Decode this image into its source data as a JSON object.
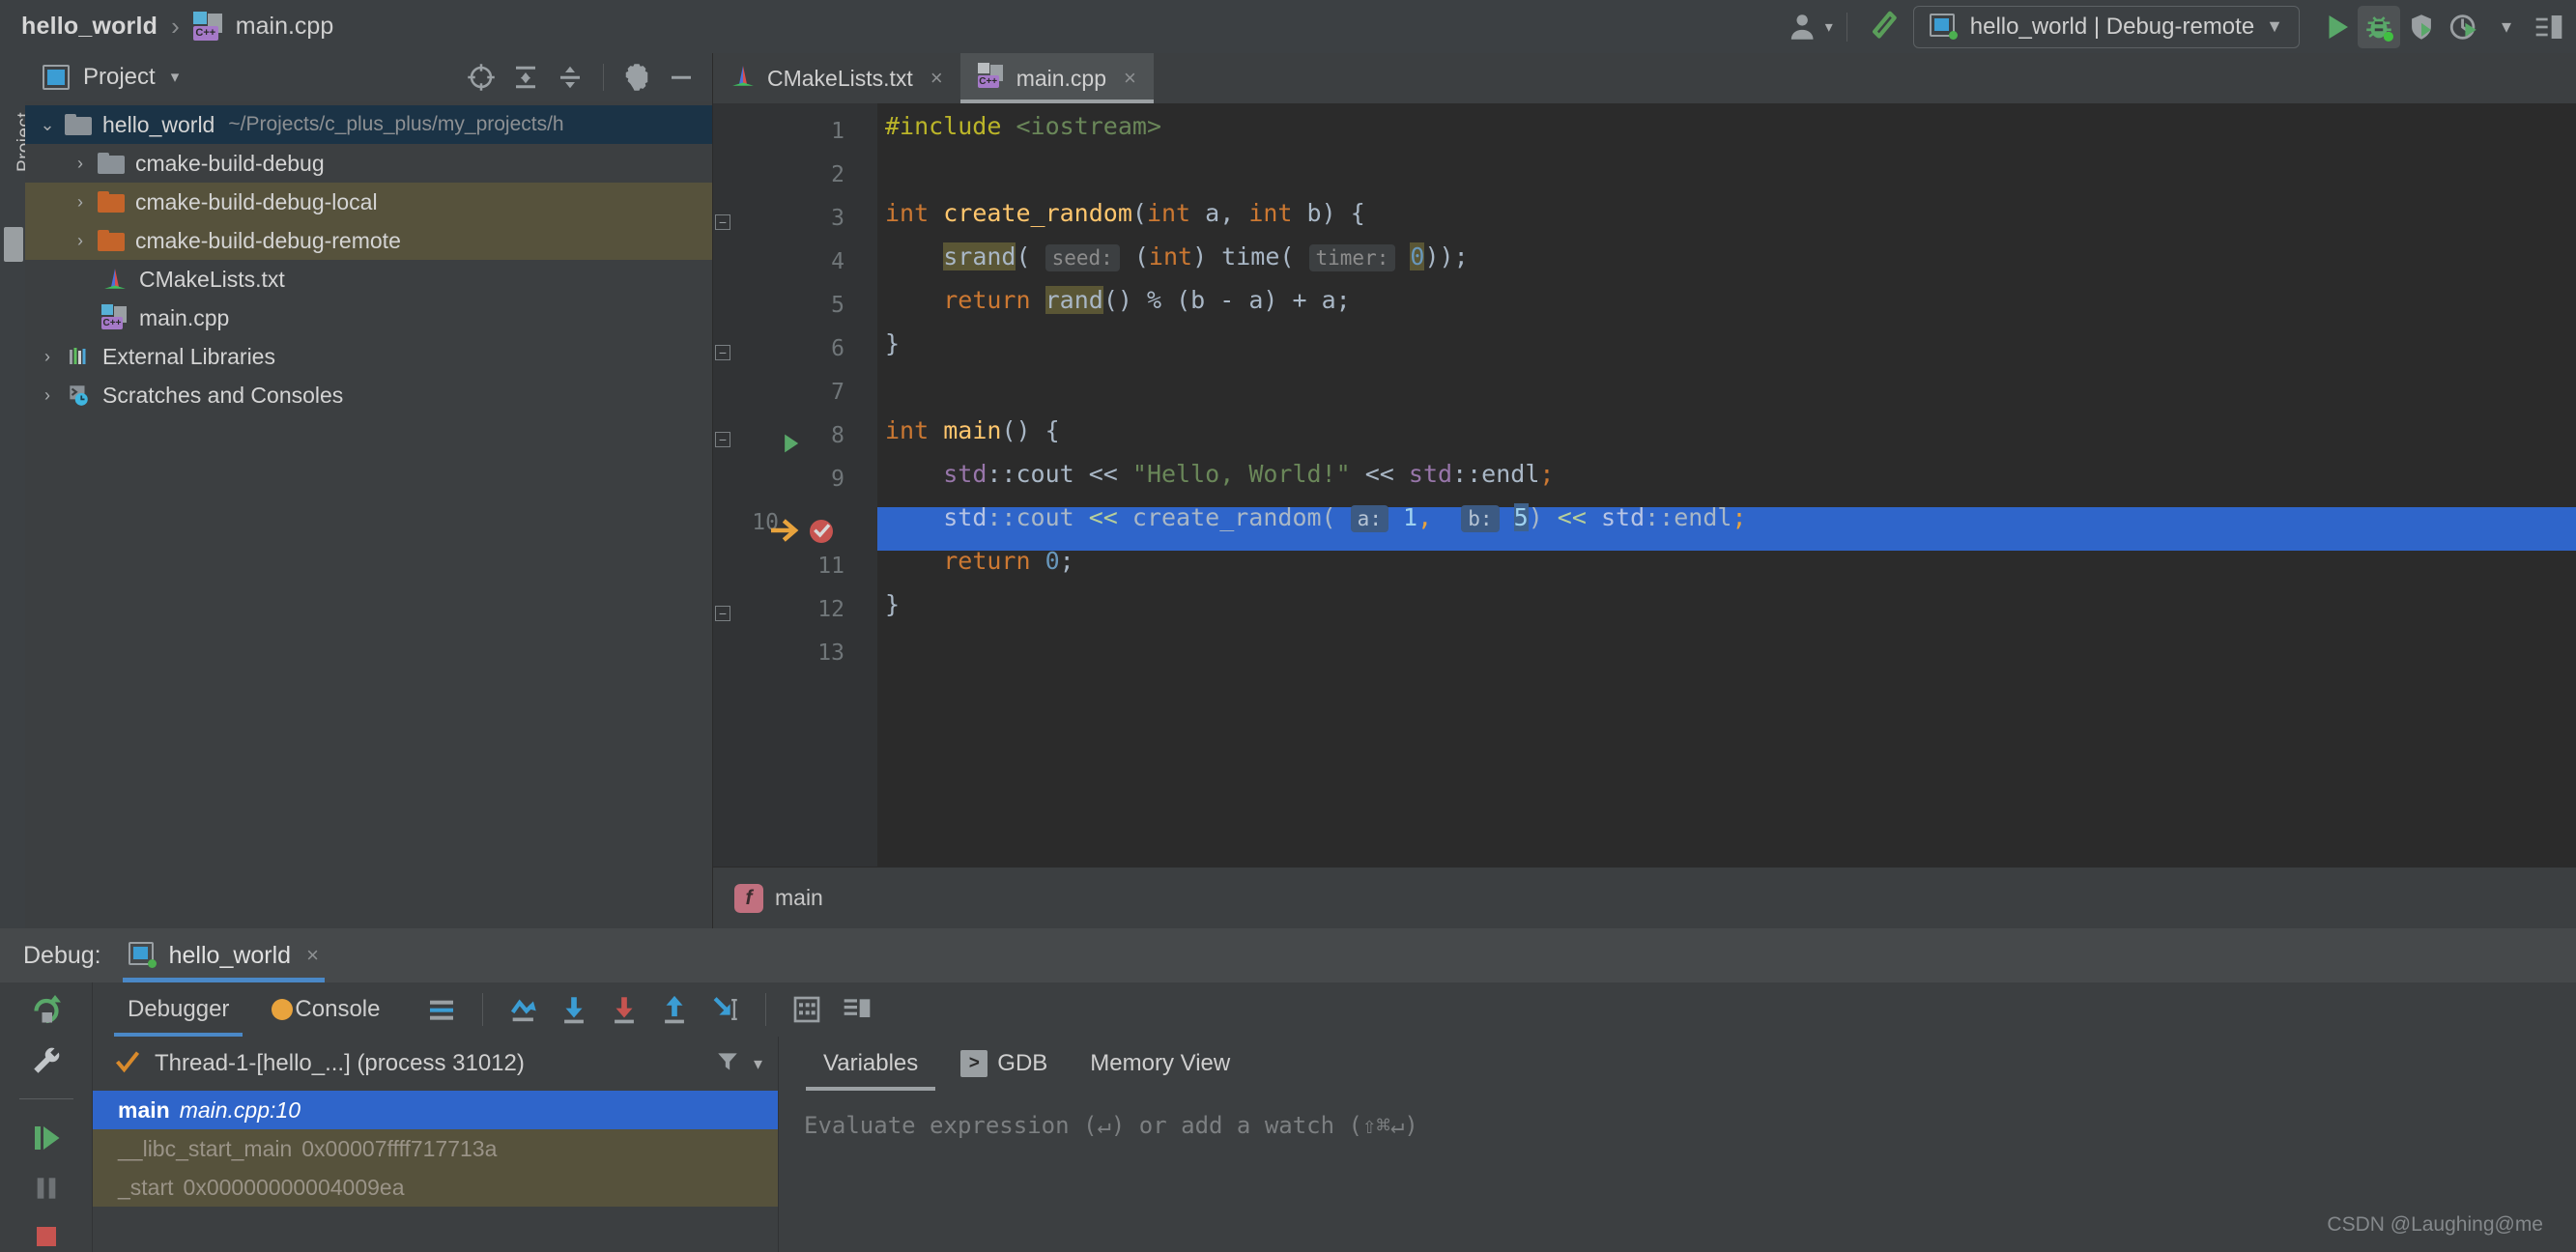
{
  "topbar": {
    "breadcrumb": {
      "project": "hello_world",
      "separator": "›",
      "file": "main.cpp"
    },
    "run_config": {
      "label": "hello_world | Debug-remote",
      "chevron": "▼"
    },
    "icons": {
      "user": "user-account-icon",
      "user_chevron": "▾",
      "hammer": "build-hammer-icon",
      "run": "run-icon",
      "debug": "debug-icon",
      "attach": "attach-to-process-icon",
      "profile": "profile-icon",
      "profile_chevron": "▾",
      "more": "more-toolbar-icon"
    }
  },
  "left_rail": {
    "label": "Project"
  },
  "project_panel": {
    "title": "Project",
    "title_chevron": "▾",
    "toolbar": {
      "locate": "locate-target-icon",
      "expand_all": "expand-all-icon",
      "collapse_all": "collapse-all-icon",
      "settings": "gear-icon",
      "hide": "minimize-icon"
    },
    "tree": [
      {
        "label": "hello_world",
        "path": "~/Projects/c_plus_plus/my_projects/h",
        "arrow": "⌄",
        "icon": "folder-grey-icon",
        "color": "#8a9197",
        "indent": 1,
        "state": "selected"
      },
      {
        "label": "cmake-build-debug",
        "path": "",
        "arrow": "›",
        "icon": "folder-grey-icon",
        "color": "#8a9197",
        "indent": 2,
        "state": "normal"
      },
      {
        "label": "cmake-build-debug-local",
        "path": "",
        "arrow": "›",
        "icon": "folder-orange-icon",
        "color": "#c4642a",
        "indent": 2,
        "state": "highlighted"
      },
      {
        "label": "cmake-build-debug-remote",
        "path": "",
        "arrow": "›",
        "icon": "folder-orange-icon",
        "color": "#c4642a",
        "indent": 2,
        "state": "highlighted"
      },
      {
        "label": "CMakeLists.txt",
        "path": "",
        "arrow": "",
        "icon": "cmake-file-icon",
        "color": "",
        "indent": 3,
        "state": "normal"
      },
      {
        "label": "main.cpp",
        "path": "",
        "arrow": "",
        "icon": "cpp-file-icon",
        "color": "",
        "indent": 3,
        "state": "normal"
      },
      {
        "label": "External Libraries",
        "path": "",
        "arrow": "›",
        "icon": "libraries-icon",
        "color": "",
        "indent": 1,
        "state": "normal"
      },
      {
        "label": "Scratches and Consoles",
        "path": "",
        "arrow": "›",
        "icon": "scratches-icon",
        "color": "",
        "indent": 1,
        "state": "normal"
      }
    ]
  },
  "editor": {
    "tabs": [
      {
        "label": "CMakeLists.txt",
        "icon": "cmake-file-icon",
        "close": "×",
        "active": false
      },
      {
        "label": "main.cpp",
        "icon": "cpp-file-icon",
        "close": "×",
        "active": true
      }
    ],
    "line_numbers": [
      "1",
      "2",
      "3",
      "4",
      "5",
      "6",
      "7",
      "8",
      "9",
      "10",
      "11",
      "12",
      "13"
    ],
    "gutter": {
      "run_marker_line": 8,
      "breakpoint_line": 10,
      "execution_pointer_line": 10
    },
    "code_lines": [
      "#include <iostream>",
      "",
      "int create_random(int a, int b) {",
      "    srand( seed: (int) time( timer: 0));",
      "    return rand() % (b - a) + a;",
      "}",
      "",
      "int main() {",
      "    std::cout << \"Hello, World!\" << std::endl;",
      "    std::cout << create_random( a: 1,  b: 5) << std::endl;",
      "    return 0;",
      "}",
      ""
    ],
    "parameter_hints": [
      "seed:",
      "timer:",
      "a:",
      "b:"
    ],
    "breadcrumb": {
      "badge": "f",
      "label": "main"
    }
  },
  "debug": {
    "header": {
      "title": "Debug:",
      "tab_label": "hello_world",
      "tab_close": "×",
      "icon": "run-config-icon"
    },
    "rail": {
      "rerun": "rerun-icon",
      "settings": "wrench-icon",
      "resume": "resume-program-icon",
      "pause": "pause-program-icon",
      "stop": "stop-icon"
    },
    "toolbar": {
      "tabs": [
        {
          "label": "Debugger",
          "icon": "",
          "active": true
        },
        {
          "label": "Console",
          "icon": "console-icon",
          "active": false
        }
      ],
      "icons": {
        "layout": "layout-settings-icon",
        "step_over": "step-over-icon",
        "step_into": "step-into-icon",
        "force_step_into": "force-step-into-icon",
        "step_out": "step-out-icon",
        "run_to_cursor": "run-to-cursor-icon",
        "evaluate": "evaluate-expression-icon",
        "settings_layout": "debug-layout-icon"
      }
    },
    "frames": {
      "thread_label": "Thread-1-[hello_...] (process 31012)",
      "thread_status_icon": "check-icon",
      "filter_icon": "filter-icon",
      "dropdown_icon": "▾",
      "list": [
        {
          "name": "main",
          "location": "main.cpp:10",
          "state": "selected"
        },
        {
          "name": "__libc_start_main",
          "location": "0x00007ffff717713a",
          "state": "dim"
        },
        {
          "name": "_start",
          "location": "0x00000000004009ea",
          "state": "dim"
        }
      ]
    },
    "variables": {
      "tabs": [
        {
          "label": "Variables",
          "icon": "",
          "active": true
        },
        {
          "label": "GDB",
          "icon": "gdb-console-icon",
          "active": false
        },
        {
          "label": "Memory View",
          "icon": "",
          "active": false
        }
      ],
      "evaluate_placeholder": "Evaluate expression (↵) or add a watch (⇧⌘↵)"
    }
  },
  "watermark": "CSDN @Laughing@me"
}
